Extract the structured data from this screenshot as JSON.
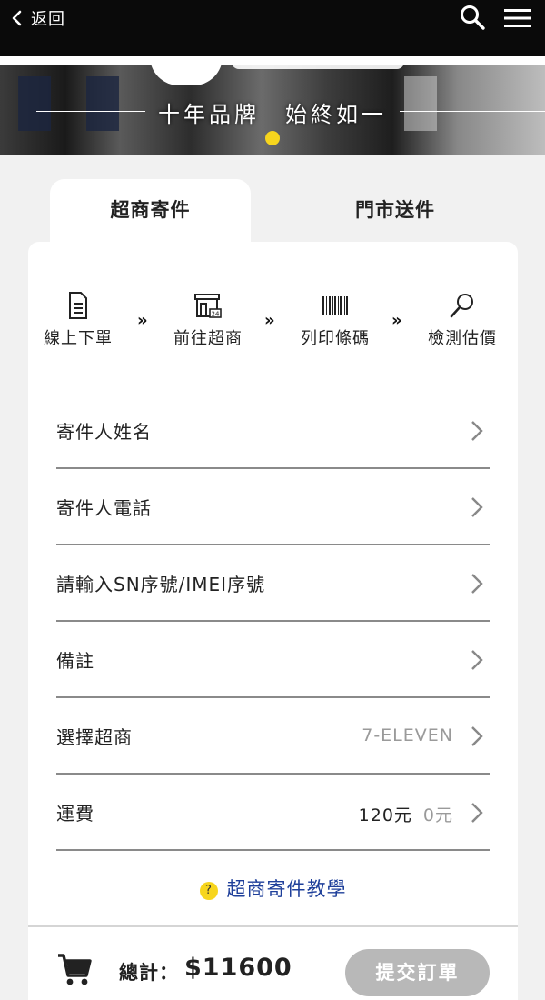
{
  "topbar": {
    "back_label": "返回"
  },
  "banner": {
    "slogan": "十年品牌　始終如一"
  },
  "tabs": [
    {
      "label": "超商寄件"
    },
    {
      "label": "門市送件"
    }
  ],
  "steps": [
    {
      "label": "線上下單",
      "icon": "document-icon"
    },
    {
      "label": "前往超商",
      "icon": "convenience-store-icon"
    },
    {
      "label": "列印條碼",
      "icon": "barcode-icon"
    },
    {
      "label": "檢測估價",
      "icon": "magnifier-icon"
    }
  ],
  "step_arrow": "»",
  "form": {
    "rows": [
      {
        "label": "寄件人姓名"
      },
      {
        "label": "寄件人電話"
      },
      {
        "label": "請輸入SN序號/IMEI序號"
      },
      {
        "label": "備註"
      },
      {
        "label": "選擇超商",
        "value": "7-ELEVEN"
      },
      {
        "label": "運費",
        "original_price": "120元",
        "value": "0元"
      }
    ]
  },
  "tutorial": {
    "icon_text": "?",
    "label": "超商寄件教學"
  },
  "footer": {
    "total_label": "總計：",
    "total_value": "$11600",
    "submit_label": "提交訂單"
  },
  "colors": {
    "accent_yellow": "#f7d51d",
    "link_blue": "#1e3f9a",
    "button_gray": "#b8b8b8"
  }
}
